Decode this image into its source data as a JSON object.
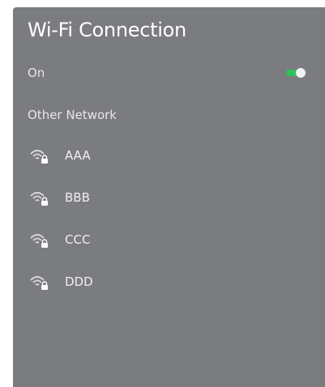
{
  "header": {
    "title": "Wi-Fi Connection"
  },
  "wifi_toggle": {
    "label": "On",
    "state": "on",
    "track_color": "#2ec05a",
    "knob_color": "#f2f2f2"
  },
  "section": {
    "other_network_label": "Other Network"
  },
  "networks": [
    {
      "name": "AAA",
      "icon": "wifi-lock-icon"
    },
    {
      "name": "BBB",
      "icon": "wifi-lock-icon"
    },
    {
      "name": "CCC",
      "icon": "wifi-lock-icon"
    },
    {
      "name": "DDD",
      "icon": "wifi-lock-icon"
    }
  ],
  "colors": {
    "panel_bg": "#7b7c80",
    "text": "#ffffff"
  }
}
